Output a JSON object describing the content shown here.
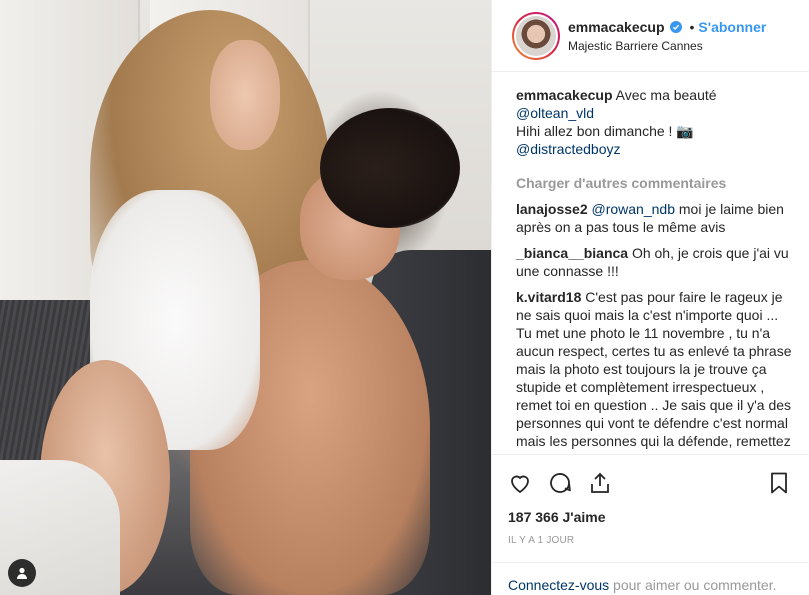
{
  "post": {
    "tag_icon": "user-tag-icon"
  },
  "header": {
    "username": "emmacakecup",
    "verified_icon": "verified-badge-icon",
    "separator": "•",
    "follow_label": "S'abonner",
    "location": "Majestic Barriere Cannes"
  },
  "caption": {
    "username": "emmacakecup",
    "line1": "Avec ma beauté",
    "mention1": "@oltean_vld",
    "line2": "Hihi allez bon dimanche ! 📷",
    "mention2": "@distractedboyz"
  },
  "load_more": "Charger d'autres commentaires",
  "comments": [
    {
      "user": "lanajosse2",
      "mention": "@rowan_ndb",
      "text": "moi je laime bien après on a pas tous le même avis"
    },
    {
      "user": "_bianca__bianca",
      "mention": "",
      "text": "Oh oh, je crois que j'ai vu une connasse !!!"
    },
    {
      "user": "k.vitard18",
      "mention": "",
      "text": "C'est pas pour faire le rageux je ne sais quoi mais la c'est n'importe quoi ... Tu met une photo le 11 novembre , tu n'a aucun respect, certes tu as enlevé ta phrase mais la photo est toujours la je trouve ça stupide et complètement irrespectueux , remet toi en question .. Je sais que il y'a des personnes qui vont te défendre c'est normal mais les personnes qui la défende, remettez vous en en question.. Merci"
    }
  ],
  "actions": {
    "like_icon": "heart-icon",
    "comment_icon": "comment-bubble-icon",
    "share_icon": "share-icon",
    "save_icon": "bookmark-icon",
    "likes": "187 366 J'aime",
    "time": "Il y a 1 jour"
  },
  "login": {
    "link": "Connectez-vous",
    "text": " pour aimer ou commenter."
  },
  "colors": {
    "link_blue": "#3897f0",
    "mention_blue": "#003569",
    "muted": "#999999"
  }
}
